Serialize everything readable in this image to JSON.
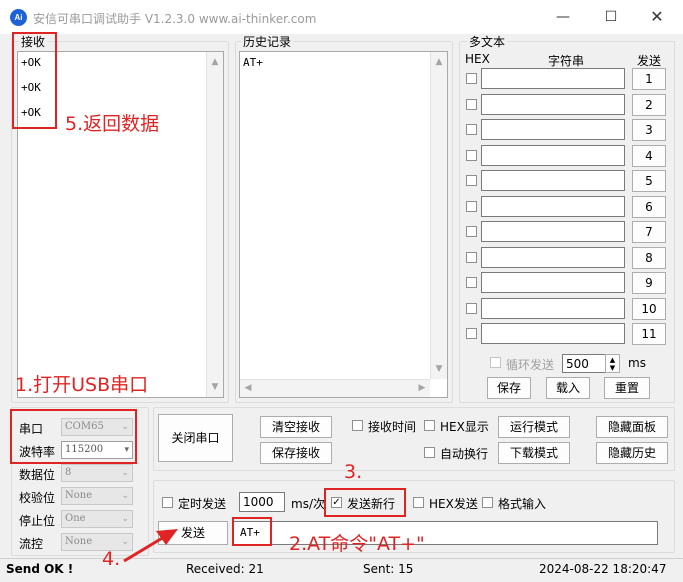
{
  "window": {
    "icon_text": "Ai",
    "title": "安信可串口调试助手 V1.2.3.0    www.ai-thinker.com"
  },
  "receive": {
    "label": "接收",
    "lines": [
      "+OK",
      "+OK",
      "+OK"
    ]
  },
  "history": {
    "label": "历史记录",
    "items": [
      "AT+"
    ]
  },
  "multi_text": {
    "label": "多文本",
    "col_hex": "HEX",
    "col_string": "字符串",
    "col_send": "发送",
    "rows": [
      {
        "button": "1",
        "value": ""
      },
      {
        "button": "2",
        "value": ""
      },
      {
        "button": "3",
        "value": ""
      },
      {
        "button": "4",
        "value": ""
      },
      {
        "button": "5",
        "value": ""
      },
      {
        "button": "6",
        "value": ""
      },
      {
        "button": "7",
        "value": ""
      },
      {
        "button": "8",
        "value": ""
      },
      {
        "button": "9",
        "value": ""
      },
      {
        "button": "10",
        "value": ""
      },
      {
        "button": "11",
        "value": ""
      }
    ],
    "loop_send_label": "循环发送",
    "loop_interval": "500",
    "loop_unit": "ms",
    "save_label": "保存",
    "load_label": "载入",
    "reset_label": "重置"
  },
  "port_settings": {
    "port_label": "串口",
    "port_value": "COM65",
    "baud_label": "波特率",
    "baud_value": "115200",
    "databits_label": "数据位",
    "databits_value": "8",
    "parity_label": "校验位",
    "parity_value": "None",
    "stopbits_label": "停止位",
    "stopbits_value": "One",
    "flow_label": "流控",
    "flow_value": "None"
  },
  "controls": {
    "close_port": "关闭串口",
    "clear_receive": "清空接收",
    "save_receive": "保存接收",
    "receive_time": "接收时间",
    "hex_display": "HEX显示",
    "run_mode": "运行模式",
    "hide_panel": "隐藏面板",
    "auto_wrap": "自动换行",
    "download_mode": "下载模式",
    "hide_history": "隐藏历史"
  },
  "send": {
    "timed_send": "定时发送",
    "interval": "1000",
    "interval_unit": "ms/次",
    "send_newline": "发送新行",
    "send_newline_checked": true,
    "hex_send": "HEX发送",
    "format_input": "格式输入",
    "send_button": "发送",
    "input_value": "AT+"
  },
  "status": {
    "state": "Send OK !",
    "received": "Received: 21",
    "sent": "Sent: 15",
    "datetime": "2024-08-22 18:20:47"
  },
  "annotations": {
    "step1": "1.打开USB串口",
    "step2": "2.AT命令\"AT+\"",
    "step3": "3.",
    "step4": "4.",
    "step5": "5.返回数据"
  },
  "colors": {
    "annotation_red": "#e02424",
    "window_bg": "#f0f0f0",
    "app_icon_blue": "#1e63d6"
  }
}
